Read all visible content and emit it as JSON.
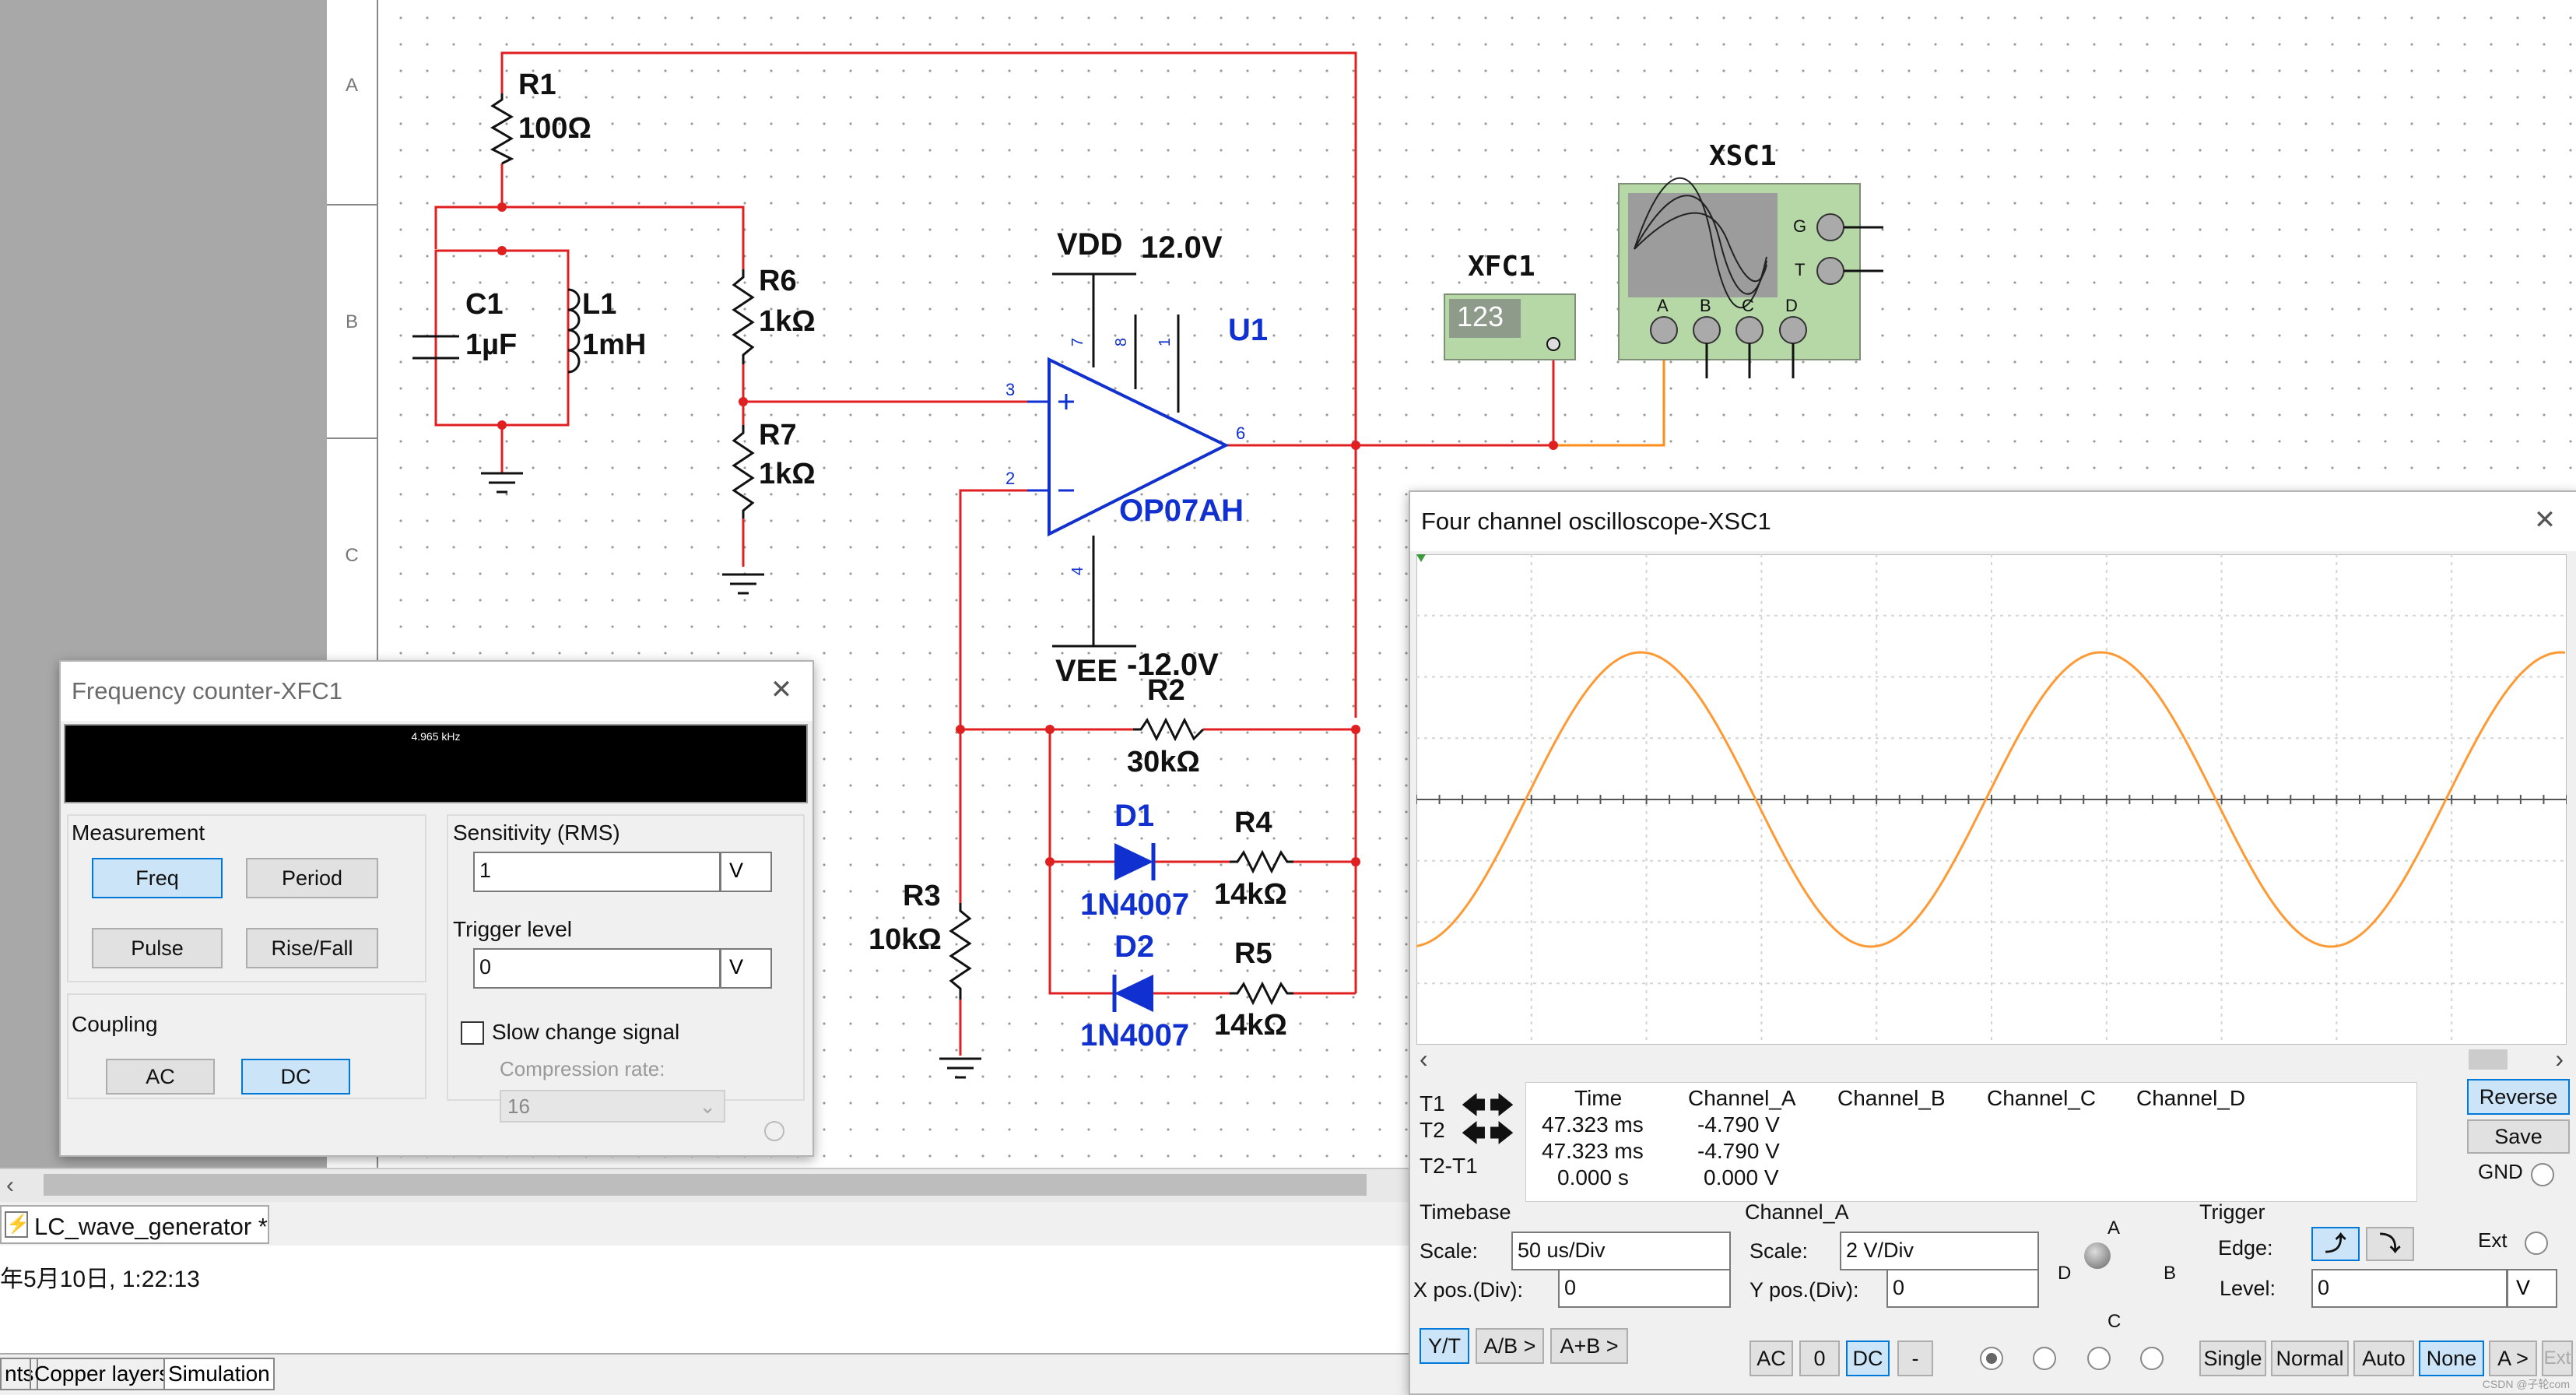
{
  "schematic": {
    "ruler_rows": [
      "A",
      "B",
      "C"
    ],
    "r1": {
      "ref": "R1",
      "val": "100Ω"
    },
    "c1": {
      "ref": "C1",
      "val": "1µF"
    },
    "l1": {
      "ref": "L1",
      "val": "1mH"
    },
    "r6": {
      "ref": "R6",
      "val": "1kΩ"
    },
    "r7": {
      "ref": "R7",
      "val": "1kΩ"
    },
    "vdd": {
      "ref": "VDD",
      "val": "12.0V"
    },
    "vee": {
      "ref": "VEE",
      "val": "-12.0V"
    },
    "u1": {
      "ref": "U1",
      "part": "OP07AH",
      "pins": [
        "7",
        "8",
        "1",
        "3",
        "2",
        "6",
        "4"
      ]
    },
    "r2": {
      "ref": "R2",
      "val": "30kΩ"
    },
    "d1": {
      "ref": "D1",
      "part": "1N4007"
    },
    "d2": {
      "ref": "D2",
      "part": "1N4007"
    },
    "r4": {
      "ref": "R4",
      "val": "14kΩ"
    },
    "r5": {
      "ref": "R5",
      "val": "14kΩ"
    },
    "r3": {
      "ref": "R3",
      "val": "10kΩ"
    },
    "xfc1": {
      "ref": "XFC1",
      "display": "123"
    },
    "xsc1": {
      "ref": "XSC1",
      "terminals": [
        "A",
        "B",
        "C",
        "D"
      ],
      "side_terminals": [
        "G",
        "T"
      ]
    }
  },
  "freq_counter": {
    "title": "Frequency counter-XFC1",
    "display": "4.965 kHz",
    "measurement_label": "Measurement",
    "buttons": {
      "freq": "Freq",
      "period": "Period",
      "pulse": "Pulse",
      "risefall": "Rise/Fall"
    },
    "coupling_label": "Coupling",
    "coupling": {
      "ac": "AC",
      "dc": "DC"
    },
    "sensitivity_label": "Sensitivity (RMS)",
    "sensitivity_value": "1",
    "sensitivity_unit": "V",
    "trigger_label": "Trigger level",
    "trigger_value": "0",
    "trigger_unit": "V",
    "slow_change": "Slow change signal",
    "compression_label": "Compression rate:",
    "compression_value": "16"
  },
  "oscilloscope": {
    "title": "Four channel oscilloscope-XSC1",
    "trace_color": "#ff9933",
    "cursor_rows": {
      "t1": "T1",
      "t2": "T2",
      "diff": "T2-T1"
    },
    "cols": {
      "time": "Time",
      "a": "Channel_A",
      "b": "Channel_B",
      "c": "Channel_C",
      "d": "Channel_D"
    },
    "t1": {
      "time": "47.323 ms",
      "a": "-4.790 V"
    },
    "t2": {
      "time": "47.323 ms",
      "a": "-4.790 V"
    },
    "diff": {
      "time": "0.000 s",
      "a": "0.000 V"
    },
    "reverse": "Reverse",
    "save": "Save",
    "gnd": "GND",
    "timebase": {
      "label": "Timebase",
      "scale_label": "Scale:",
      "scale": "50 us/Div",
      "xpos_label": "X pos.(Div):",
      "xpos": "0",
      "modes": [
        "Y/T",
        "A/B >",
        "A+B >"
      ]
    },
    "channel": {
      "label": "Channel_A",
      "scale_label": "Scale:",
      "scale": "2  V/Div",
      "ypos_label": "Y pos.(Div):",
      "ypos": "0",
      "coupling": [
        "AC",
        "0",
        "DC",
        "-"
      ],
      "knob_labels": [
        "A",
        "B",
        "C",
        "D"
      ]
    },
    "trigger": {
      "label": "Trigger",
      "edge_label": "Edge:",
      "ext": "Ext",
      "level_label": "Level:",
      "level": "0",
      "level_unit": "V",
      "modes": [
        "Single",
        "Normal",
        "Auto",
        "None",
        "A >",
        "Ext"
      ]
    },
    "wave": {
      "period_div": 4.0,
      "amplitude_div": 2.4,
      "phase_div": 0.95
    }
  },
  "bottom": {
    "tab": "LC_wave_generator *",
    "log": "年5月10日, 1:22:13",
    "tabs": [
      "nts",
      "Copper layers",
      "Simulation"
    ]
  },
  "watermark": "CSDN @子轮com"
}
